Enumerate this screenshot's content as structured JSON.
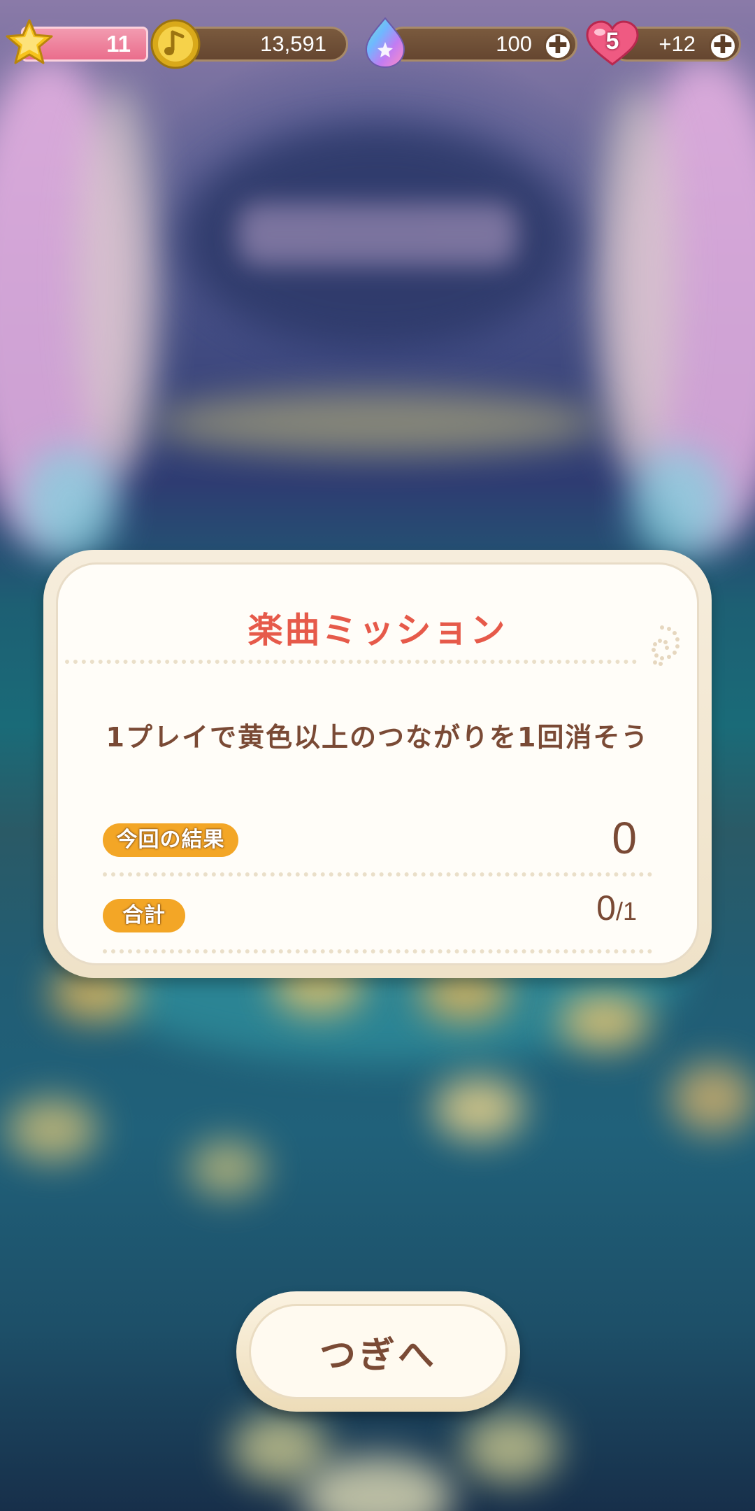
{
  "status_bar": {
    "level": "11",
    "coins": "13,591",
    "gems": "100",
    "lives_count": "5",
    "lives_bonus": "+12",
    "plus_symbol": "✚"
  },
  "dialog": {
    "title": "楽曲ミッション",
    "mission": "1プレイで黄色以上のつながりを1回消そう",
    "result_label": "今回の結果",
    "result_value": "0",
    "total_label": "合計",
    "total_value": "0",
    "total_sep": "/",
    "total_max": "1"
  },
  "next_button": {
    "label": "つぎへ"
  },
  "icons": {
    "level": "star-icon",
    "coins": "music-coin-icon",
    "gems": "rainbow-gem-icon",
    "lives": "heart-icon"
  },
  "colors": {
    "title": "#e65a4a",
    "text": "#7a4a35",
    "tag": "#f3a626",
    "level_pill": "#ea6d8c",
    "currency_pill": "#6f4f37"
  }
}
